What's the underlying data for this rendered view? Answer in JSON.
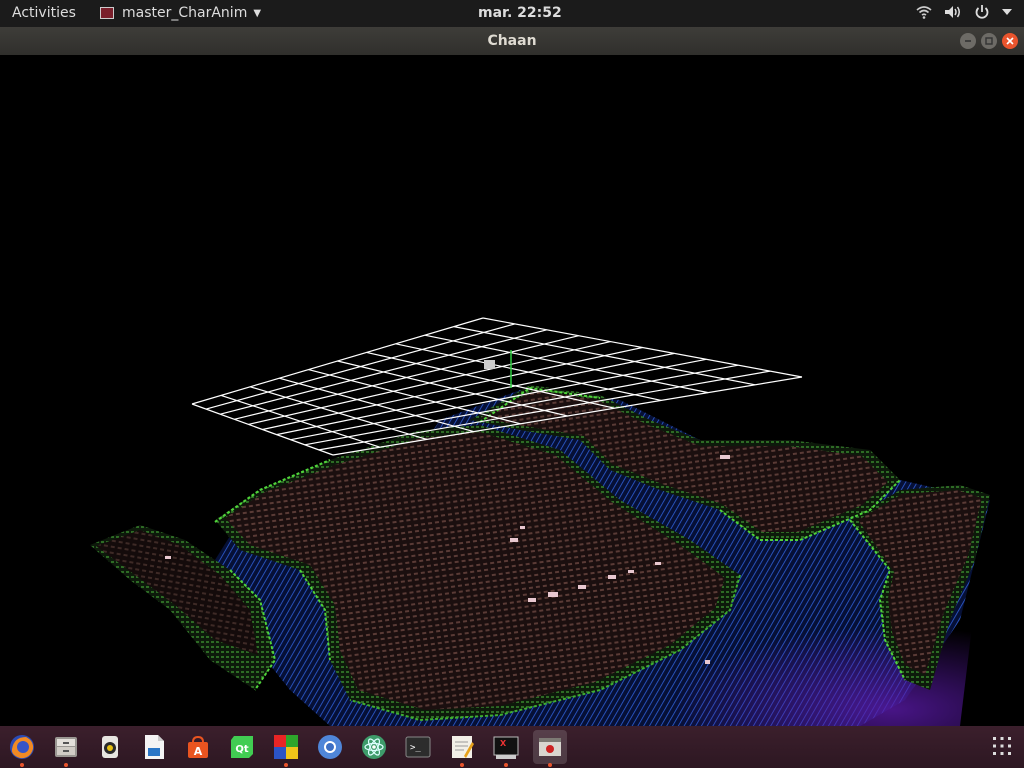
{
  "topbar": {
    "activities": "Activities",
    "app_name": "master_CharAnim",
    "clock": "mar. 22:52"
  },
  "window": {
    "title": "Chaan"
  },
  "dock": {
    "items": [
      {
        "name": "firefox",
        "running": true
      },
      {
        "name": "files",
        "running": true
      },
      {
        "name": "rhythmbox",
        "running": false
      },
      {
        "name": "libreoffice-writer",
        "running": false
      },
      {
        "name": "software-center",
        "running": false
      },
      {
        "name": "qt-creator",
        "running": false
      },
      {
        "name": "color-app",
        "running": true
      },
      {
        "name": "chromium",
        "running": false
      },
      {
        "name": "atom",
        "running": false
      },
      {
        "name": "terminal",
        "running": false
      },
      {
        "name": "text-editor",
        "running": true
      },
      {
        "name": "xterm",
        "running": true
      },
      {
        "name": "chaan-app",
        "running": true,
        "active": true
      }
    ]
  },
  "colors": {
    "topbar": "#1b1b1b",
    "titlebar": "#3a3935",
    "dock": "#341b27",
    "accent": "#e9542d"
  }
}
